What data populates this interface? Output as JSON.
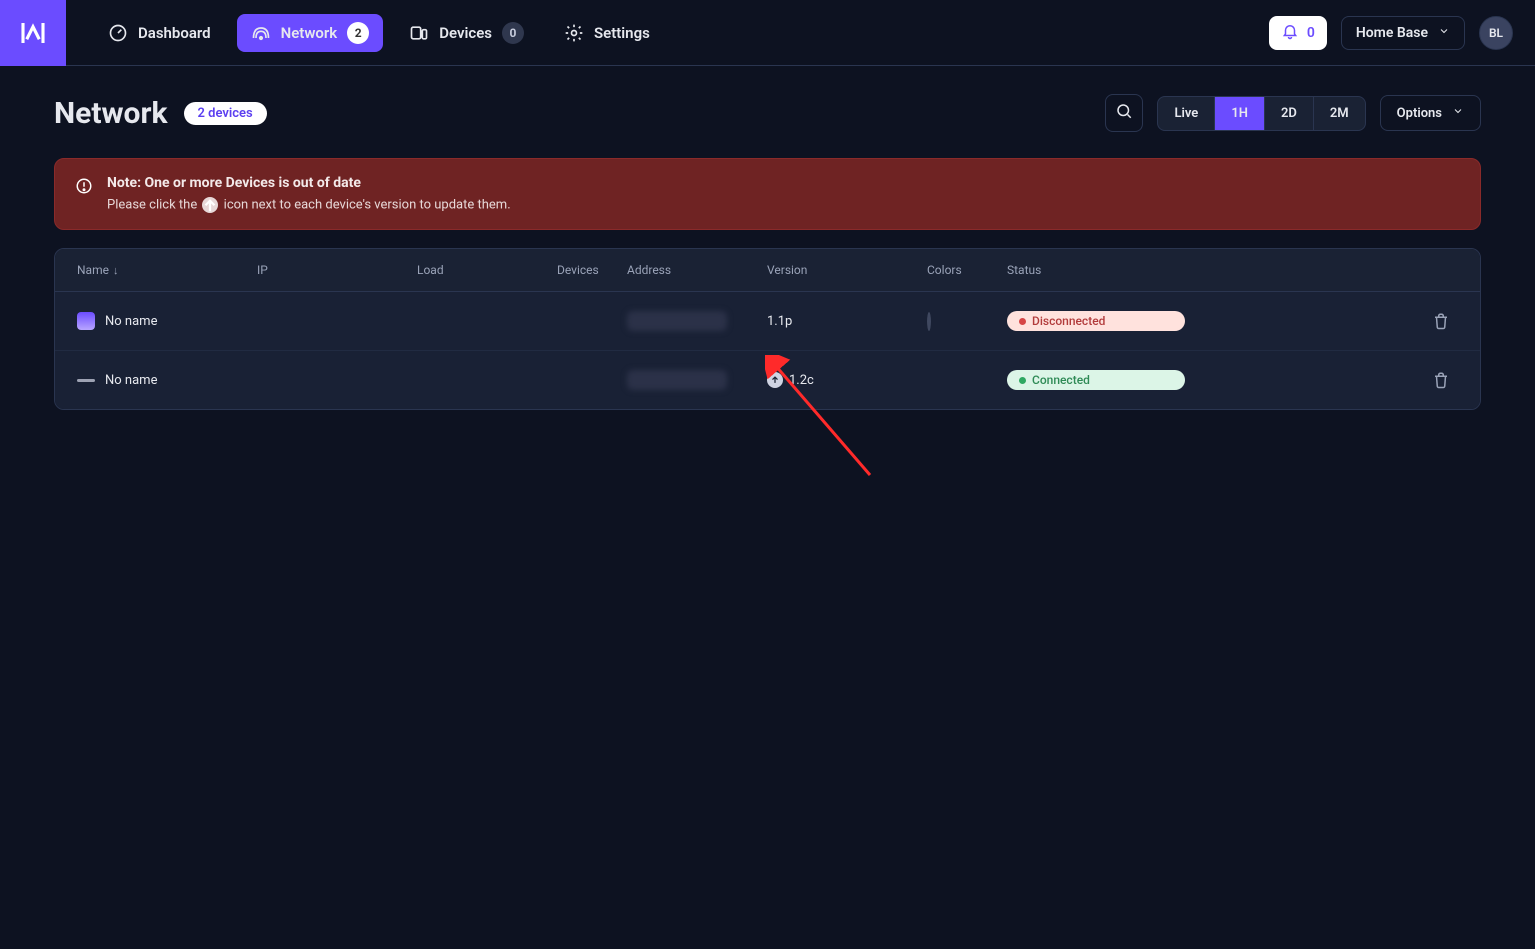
{
  "nav": {
    "dashboard": "Dashboard",
    "network": "Network",
    "network_badge": "2",
    "devices": "Devices",
    "devices_badge": "0",
    "settings": "Settings"
  },
  "topright": {
    "notif_count": "0",
    "location": "Home Base",
    "avatar_initials": "BL"
  },
  "page": {
    "title": "Network",
    "count_pill": "2 devices",
    "timerange": {
      "t0": "Live",
      "t1": "1H",
      "t2": "2D",
      "t3": "2M"
    },
    "options": "Options"
  },
  "alert": {
    "title": "Note: One or more Devices is out of date",
    "msg_before": "Please click the ",
    "msg_after": " icon next to each device's version to update them."
  },
  "table": {
    "headers": {
      "name": "Name",
      "ip": "IP",
      "load": "Load",
      "devices": "Devices",
      "address": "Address",
      "version": "Version",
      "colors": "Colors",
      "status": "Status"
    },
    "rows": [
      {
        "name": "No name",
        "icon_variant": "bulb",
        "ip": "",
        "load": "",
        "devices": "",
        "address": "blurred",
        "version": "1.1p",
        "has_update": false,
        "color_dot": true,
        "status": "Disconnected",
        "status_variant": "red"
      },
      {
        "name": "No name",
        "icon_variant": "line",
        "ip": "",
        "load": "",
        "devices": "",
        "address": "blurred",
        "version": "1.2c",
        "has_update": true,
        "color_dot": false,
        "status": "Connected",
        "status_variant": "green"
      }
    ]
  }
}
